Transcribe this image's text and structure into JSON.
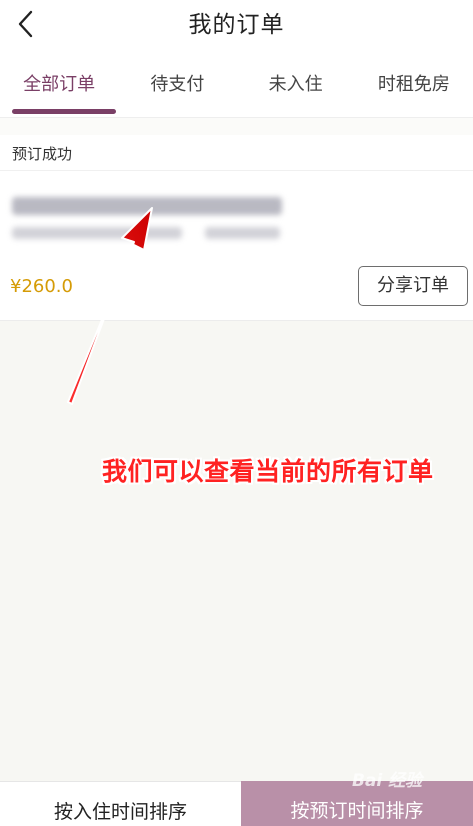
{
  "header": {
    "title": "我的订单",
    "back_icon": "chevron-left-icon"
  },
  "tabs": [
    {
      "label": "全部订单",
      "active": true
    },
    {
      "label": "待支付",
      "active": false
    },
    {
      "label": "未入住",
      "active": false
    },
    {
      "label": "时租免房",
      "active": false
    }
  ],
  "order": {
    "status": "预订成功",
    "price": "¥260.0",
    "share_label": "分享订单"
  },
  "annotation": {
    "text": "我们可以查看当前的所有订单",
    "color": "#ff2222"
  },
  "bottom_bar": {
    "sort_checkin": "按入住时间排序",
    "sort_booking": "按预订时间排序"
  },
  "watermark": "Bai 经验",
  "colors": {
    "accent": "#7a3f66",
    "price": "#d59b06",
    "bottom_active": "#b990a8"
  }
}
